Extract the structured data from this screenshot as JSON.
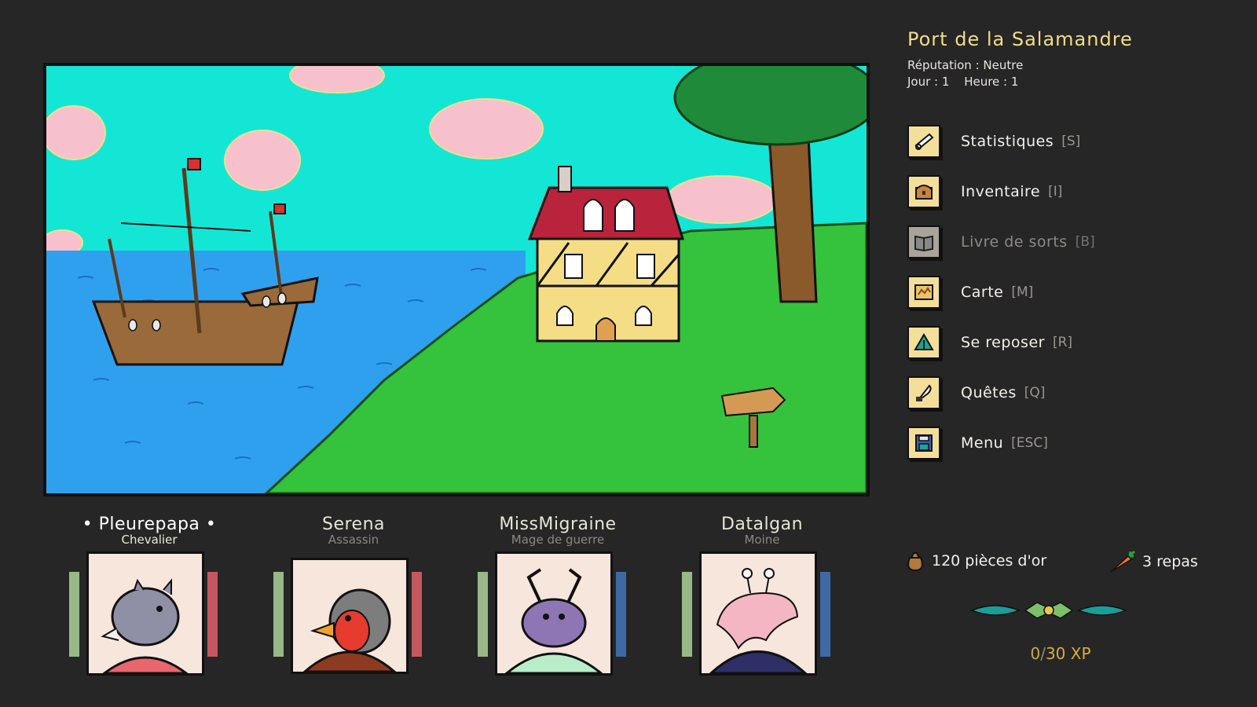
{
  "location": {
    "name": "Port de la Salamandre",
    "reputation": "Réputation : Neutre",
    "day": "Jour : 1",
    "hour": "Heure : 1"
  },
  "menu": [
    {
      "label": "Statistiques",
      "key": "[S]",
      "icon": "scroll-icon",
      "enabled": true
    },
    {
      "label": "Inventaire",
      "key": "[I]",
      "icon": "chest-icon",
      "enabled": true
    },
    {
      "label": "Livre de sorts",
      "key": "[B]",
      "icon": "spellbook-icon",
      "enabled": false
    },
    {
      "label": "Carte",
      "key": "[M]",
      "icon": "map-icon",
      "enabled": true
    },
    {
      "label": "Se reposer",
      "key": "[R]",
      "icon": "tent-icon",
      "enabled": true
    },
    {
      "label": "Quêtes",
      "key": "[Q]",
      "icon": "quill-icon",
      "enabled": true
    },
    {
      "label": "Menu",
      "key": "[ESC]",
      "icon": "save-disk-icon",
      "enabled": true
    }
  ],
  "party": [
    {
      "name": "• Pleurepapa •",
      "class": "Chevalier",
      "active": true,
      "portrait": "rhino-portrait",
      "bar_left_color": "#98b887",
      "bar_right_color": "#c4575f"
    },
    {
      "name": "Serena",
      "class": "Assassin",
      "active": false,
      "portrait": "robin-portrait",
      "bar_left_color": "#98b887",
      "bar_right_color": "#c4575f"
    },
    {
      "name": "MissMigraine",
      "class": "Mage de guerre",
      "active": false,
      "portrait": "beetle-portrait",
      "bar_left_color": "#98b887",
      "bar_right_color": "#3d6aa5"
    },
    {
      "name": "Datalgan",
      "class": "Moine",
      "active": false,
      "portrait": "snail-portrait",
      "bar_left_color": "#98b887",
      "bar_right_color": "#3d6aa5"
    }
  ],
  "resources": {
    "gold": "120 pièces d'or",
    "meals": "3 repas"
  },
  "xp": {
    "current": "0",
    "separator": "/",
    "max": "30",
    "unit": " XP"
  },
  "colors": {
    "sky": "#14e6d6",
    "grass": "#35c23c",
    "sea": "#2fa0ee",
    "title": "#f2dc8a"
  }
}
